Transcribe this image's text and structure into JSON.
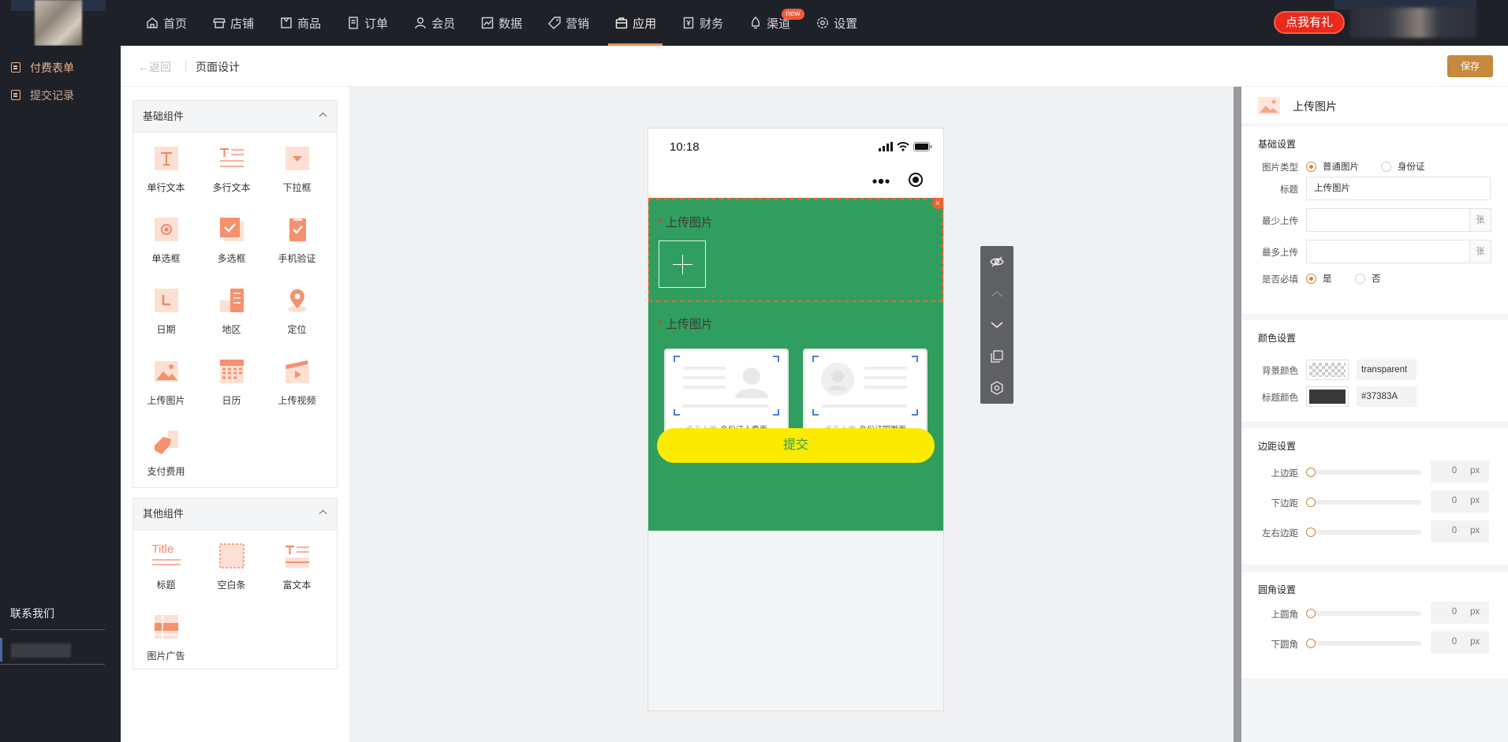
{
  "nav": {
    "items": [
      {
        "label": "首页",
        "icon": "home-icon"
      },
      {
        "label": "店铺",
        "icon": "store-icon"
      },
      {
        "label": "商品",
        "icon": "goods-icon"
      },
      {
        "label": "订单",
        "icon": "order-icon"
      },
      {
        "label": "会员",
        "icon": "member-icon"
      },
      {
        "label": "数据",
        "icon": "data-icon"
      },
      {
        "label": "营销",
        "icon": "tag-icon"
      },
      {
        "label": "应用",
        "icon": "apps-icon",
        "active": true
      },
      {
        "label": "财务",
        "icon": "finance-icon"
      },
      {
        "label": "渠道",
        "icon": "channel-icon",
        "badge": "new"
      },
      {
        "label": "设置",
        "icon": "gear-icon"
      }
    ],
    "gift_button": "点我有礼",
    "accent": "#ef8a47"
  },
  "sidebar": {
    "items": [
      "付费表单",
      "提交记录"
    ],
    "contact": "联系我们"
  },
  "header": {
    "back": "返回",
    "title": "页面设计",
    "save": "保存"
  },
  "components": {
    "basic_title": "基础组件",
    "basic": [
      "单行文本",
      "多行文本",
      "下拉框",
      "单选框",
      "多选框",
      "手机验证",
      "日期",
      "地区",
      "定位",
      "上传图片",
      "日历",
      "上传视频",
      "支付费用"
    ],
    "other_title": "其他组件",
    "other": [
      "标题",
      "空白条",
      "富文本",
      "图片广告"
    ],
    "title_icon_text": "Title"
  },
  "phone": {
    "time": "10:18",
    "field1_label": "上传图片",
    "field2_label": "上传图片",
    "id_front_hint": "点击上传",
    "id_front_label": "身份证人像面",
    "id_back_hint": "点击上传",
    "id_back_label": "身份证国徽面",
    "submit": "提交",
    "bg_color": "#2f9e5e",
    "submit_color": "#fcea00"
  },
  "props": {
    "title": "上传图片",
    "basic_title": "基础设置",
    "image_type_label": "图片类型",
    "image_type_options": [
      "普通图片",
      "身份证"
    ],
    "image_type_selected": "普通图片",
    "field_title_label": "标题",
    "field_title_value": "上传图片",
    "min_upload_label": "最少上传",
    "max_upload_label": "最多上传",
    "unit_zhang": "张",
    "required_label": "是否必填",
    "required_options": [
      "是",
      "否"
    ],
    "required_selected": "是",
    "color_title": "颜色设置",
    "bg_color_label": "背景颜色",
    "bg_color_value": "transparent",
    "title_color_label": "标题颜色",
    "title_color_value": "#37383A",
    "margin_title": "边距设置",
    "margin_top_label": "上边距",
    "margin_bottom_label": "下边距",
    "margin_lr_label": "左右边距",
    "radius_title": "圆角设置",
    "radius_top_label": "上圆角",
    "radius_bottom_label": "下圆角",
    "zero": "0",
    "unit_px": "px"
  }
}
